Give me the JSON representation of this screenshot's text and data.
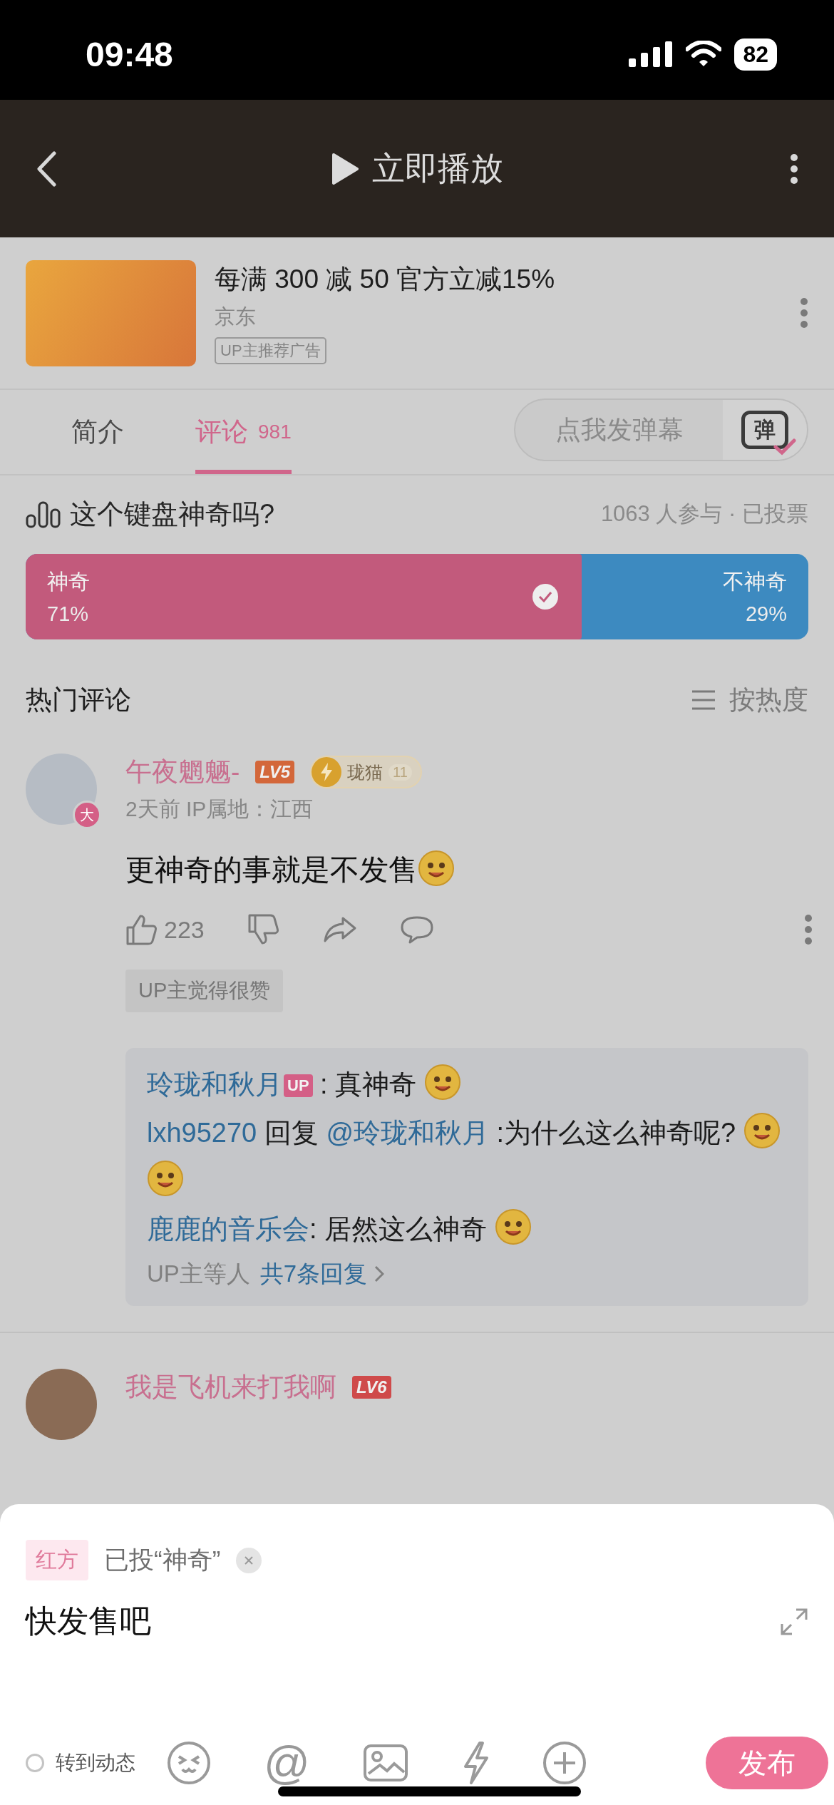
{
  "status_bar": {
    "time": "09:48",
    "battery": "82"
  },
  "header": {
    "play_label": "立即播放"
  },
  "ad": {
    "title": "每满 300 减 50 官方立减15%",
    "source": "京东",
    "tag": "UP主推荐广告"
  },
  "tabs": [
    {
      "label": "简介",
      "selected": false
    },
    {
      "label": "评论",
      "count": "981",
      "selected": true
    }
  ],
  "danmaku": {
    "placeholder": "点我发弹幕",
    "icon_text": "弹"
  },
  "poll": {
    "question": "这个键盘神奇吗?",
    "stats": "1063 人参与 · 已投票",
    "level": 0.71,
    "options": [
      {
        "label": "神奇",
        "percent": "71%",
        "selected": true,
        "color": "#c25a7c"
      },
      {
        "label": "不神奇",
        "percent": "29%",
        "selected": false,
        "color": "#3d8ac0"
      }
    ]
  },
  "comments_header": {
    "title": "热门评论",
    "sort": "按热度"
  },
  "comments": [
    {
      "avatar_badge": "大",
      "username": "午夜魍魉-",
      "user_level": "LV5",
      "medal": {
        "name": "珑猫",
        "rank": "11"
      },
      "time": "2天前",
      "location": "IP属地：江西",
      "content": [
        {
          "kind": "text",
          "text": "更神奇的事就是不发售"
        },
        {
          "kind": "emoji"
        }
      ],
      "likes": "223",
      "up_tag": "UP主觉得很赞",
      "replies": [
        [
          {
            "kind": "user",
            "text": "玲珑和秋月"
          },
          {
            "kind": "up_badge",
            "text": "UP"
          },
          {
            "kind": "text",
            "text": " : 真神奇 "
          },
          {
            "kind": "emoji"
          }
        ],
        [
          {
            "kind": "user",
            "text": "lxh95270"
          },
          {
            "kind": "text",
            "text": " 回复 "
          },
          {
            "kind": "user",
            "text": "@玲珑和秋月"
          },
          {
            "kind": "text",
            "text": " :为什么这么神奇呢? "
          },
          {
            "kind": "emoji"
          },
          {
            "kind": "emoji"
          }
        ],
        [
          {
            "kind": "user",
            "text": "鹿鹿的音乐会"
          },
          {
            "kind": "text",
            "text": ": 居然这么神奇 "
          },
          {
            "kind": "emoji"
          }
        ]
      ],
      "reply_summary": {
        "prefix": "UP主等人",
        "link": "共7条回复"
      }
    },
    {
      "username": "我是飞机来打我啊",
      "user_level": "LV6"
    }
  ],
  "compose": {
    "vote_side": "红方",
    "vote_text": "已投“神奇”",
    "value": "快发售吧",
    "repost_label": "转到动态",
    "repost_checked": false,
    "tools": [
      {
        "kind": "emoji"
      },
      {
        "kind": "mention",
        "glyph": "@"
      },
      {
        "kind": "image"
      },
      {
        "kind": "lightning"
      },
      {
        "kind": "add"
      }
    ],
    "submit": "发布"
  }
}
